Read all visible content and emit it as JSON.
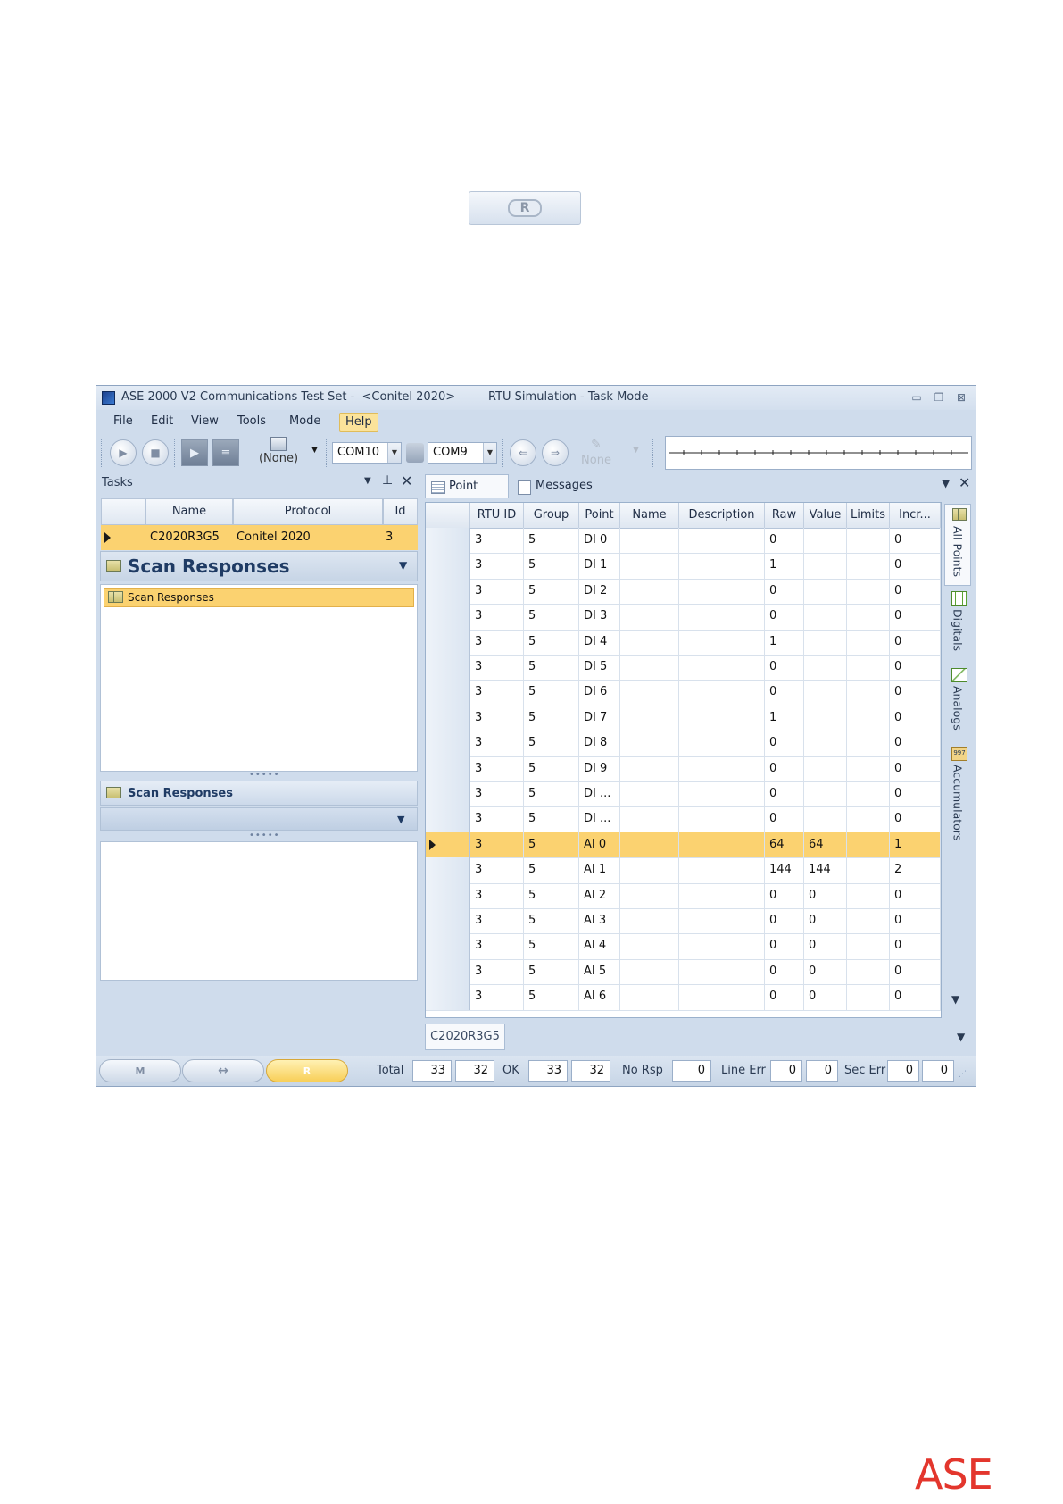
{
  "top_mode_button": {
    "label": "R"
  },
  "window": {
    "title": "ASE 2000 V2 Communications Test Set -  <Conitel 2020>",
    "mode_title": "RTU Simulation - Task Mode",
    "controls": {
      "minimize": "▭",
      "restore": "❐",
      "close": "⊠"
    }
  },
  "menu": [
    "File",
    "Edit",
    "View",
    "Tools",
    "Mode",
    "Help"
  ],
  "active_menu": "Help",
  "toolbar": {
    "none_label": "(None)",
    "com_left": "COM10",
    "com_right": "COM9",
    "none_disabled": "None"
  },
  "tasks": {
    "title": "Tasks",
    "columns": [
      "Name",
      "Protocol",
      "Id"
    ],
    "row": {
      "name": "C2020R3G5",
      "protocol": "Conitel 2020",
      "id": "3"
    }
  },
  "scan": {
    "header": "Scan Responses",
    "item": "Scan Responses",
    "nav_label": "Scan Responses"
  },
  "point_list": {
    "tabs": [
      "Point List",
      "Messages"
    ],
    "columns": [
      "RTU ID",
      "Group",
      "Point",
      "Name",
      "Description",
      "Raw",
      "Value",
      "Limits",
      "Incr..."
    ],
    "rows": [
      [
        "3",
        "5",
        "DI  0",
        "",
        "",
        "0",
        "",
        "",
        "0"
      ],
      [
        "3",
        "5",
        "DI  1",
        "",
        "",
        "1",
        "",
        "",
        "0"
      ],
      [
        "3",
        "5",
        "DI  2",
        "",
        "",
        "0",
        "",
        "",
        "0"
      ],
      [
        "3",
        "5",
        "DI  3",
        "",
        "",
        "0",
        "",
        "",
        "0"
      ],
      [
        "3",
        "5",
        "DI  4",
        "",
        "",
        "1",
        "",
        "",
        "0"
      ],
      [
        "3",
        "5",
        "DI  5",
        "",
        "",
        "0",
        "",
        "",
        "0"
      ],
      [
        "3",
        "5",
        "DI  6",
        "",
        "",
        "0",
        "",
        "",
        "0"
      ],
      [
        "3",
        "5",
        "DI  7",
        "",
        "",
        "1",
        "",
        "",
        "0"
      ],
      [
        "3",
        "5",
        "DI  8",
        "",
        "",
        "0",
        "",
        "",
        "0"
      ],
      [
        "3",
        "5",
        "DI  9",
        "",
        "",
        "0",
        "",
        "",
        "0"
      ],
      [
        "3",
        "5",
        "DI ...",
        "",
        "",
        "0",
        "",
        "",
        "0"
      ],
      [
        "3",
        "5",
        "DI ...",
        "",
        "",
        "0",
        "",
        "",
        "0"
      ],
      [
        "3",
        "5",
        "AI  0",
        "",
        "",
        "64",
        "64",
        "",
        "1"
      ],
      [
        "3",
        "5",
        "AI  1",
        "",
        "",
        "144",
        "144",
        "",
        "2"
      ],
      [
        "3",
        "5",
        "AI  2",
        "",
        "",
        "0",
        "0",
        "",
        "0"
      ],
      [
        "3",
        "5",
        "AI  3",
        "",
        "",
        "0",
        "0",
        "",
        "0"
      ],
      [
        "3",
        "5",
        "AI  4",
        "",
        "",
        "0",
        "0",
        "",
        "0"
      ],
      [
        "3",
        "5",
        "AI  5",
        "",
        "",
        "0",
        "0",
        "",
        "0"
      ],
      [
        "3",
        "5",
        "AI  6",
        "",
        "",
        "0",
        "0",
        "",
        "0"
      ]
    ],
    "selected_row": 12,
    "side_tabs": [
      "All Points",
      "Digitals",
      "Analogs",
      "Accumulators"
    ],
    "accumulator_icon_text": "997",
    "footer_tab": "C2020R3G5"
  },
  "status": {
    "mode_pills": [
      "M",
      "↔",
      "R"
    ],
    "total_label": "Total",
    "total_a": "33",
    "total_b": "32",
    "ok_label": "OK",
    "ok_a": "33",
    "ok_b": "32",
    "norsp_label": "No Rsp",
    "norsp": "0",
    "lineerr_label": "Line Err",
    "lineerr_a": "0",
    "lineerr_b": "0",
    "secerr_label": "Sec Err",
    "secerr_a": "0",
    "secerr_b": "0"
  },
  "logo": "ASE",
  "colors": {
    "accent": "#fbd270",
    "logo": "#e3362d",
    "frame": "#cfdcec"
  }
}
